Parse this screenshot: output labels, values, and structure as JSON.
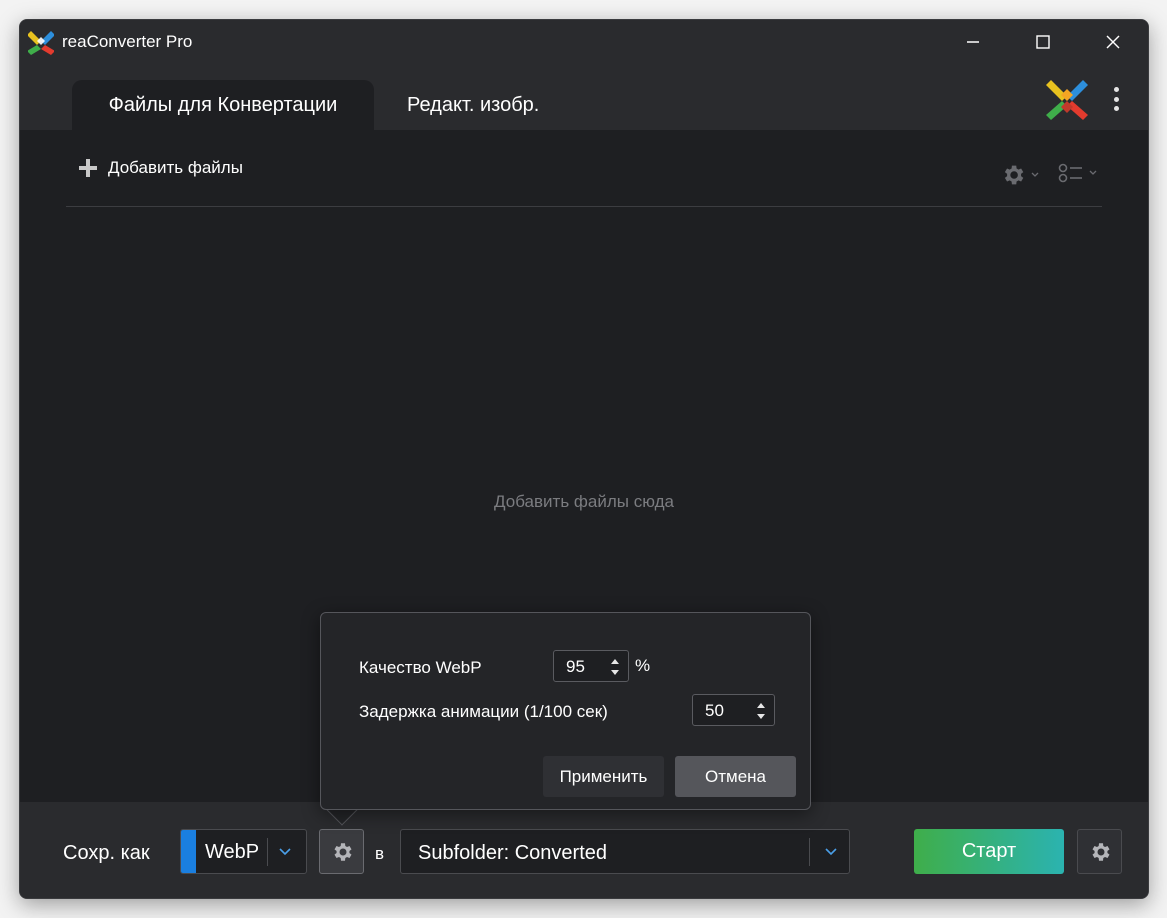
{
  "window": {
    "title": "reaConverter Pro"
  },
  "tabs": {
    "files": "Файлы для Конвертации",
    "edit": "Редакт. изобр."
  },
  "toolbar": {
    "add_files": "Добавить файлы"
  },
  "main": {
    "drop_hint": "Добавить файлы сюда"
  },
  "popup": {
    "quality_label": "Качество WebP",
    "quality_value": "95",
    "quality_unit": "%",
    "delay_label": "Задержка анимации (1/100 сек)",
    "delay_value": "50",
    "apply": "Применить",
    "cancel": "Отмена"
  },
  "bottom": {
    "save_as_label": "Сохр. как",
    "format_value": "WebP",
    "to_label": "в",
    "destination_value": "Subfolder: Converted",
    "start": "Старт"
  },
  "colors": {
    "background": "#1e1f22",
    "panel": "#2a2b2e",
    "format_accent": "#1a7fe0",
    "chevron_accent": "#4a9fe8",
    "start_gradient_from": "#3fae4a",
    "start_gradient_to": "#2bb3b0"
  }
}
